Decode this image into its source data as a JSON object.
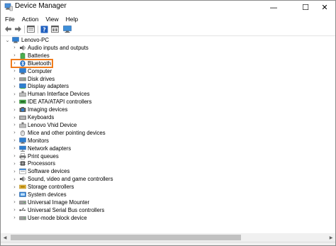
{
  "window": {
    "title": "Device Manager",
    "minimize_glyph": "—",
    "maximize_glyph": "☐",
    "close_glyph": "✕"
  },
  "menu": [
    "File",
    "Action",
    "View",
    "Help"
  ],
  "toolbar": {
    "buttons": [
      "back-arrow-icon",
      "forward-arrow-icon",
      "properties-icon",
      "help-icon",
      "show-hidden-icon",
      "monitor-icon"
    ]
  },
  "tree": {
    "root": "Lenovo-PC",
    "items": [
      {
        "label": "Audio inputs and outputs",
        "icon": "speaker-icon"
      },
      {
        "label": "Batteries",
        "icon": "battery-icon"
      },
      {
        "label": "Bluetooth",
        "icon": "bluetooth-icon"
      },
      {
        "label": "Computer",
        "icon": "computer-icon"
      },
      {
        "label": "Disk drives",
        "icon": "disk-drive-icon"
      },
      {
        "label": "Display adapters",
        "icon": "display-adapter-icon"
      },
      {
        "label": "Human Interface Devices",
        "icon": "hid-icon"
      },
      {
        "label": "IDE ATA/ATAPI controllers",
        "icon": "ide-controller-icon"
      },
      {
        "label": "Imaging devices",
        "icon": "camera-icon"
      },
      {
        "label": "Keyboards",
        "icon": "keyboard-icon"
      },
      {
        "label": "Lenovo Vhid Device",
        "icon": "hid-icon"
      },
      {
        "label": "Mice and other pointing devices",
        "icon": "mouse-icon"
      },
      {
        "label": "Monitors",
        "icon": "monitor-icon"
      },
      {
        "label": "Network adapters",
        "icon": "network-adapter-icon"
      },
      {
        "label": "Print queues",
        "icon": "printer-icon"
      },
      {
        "label": "Processors",
        "icon": "processor-icon"
      },
      {
        "label": "Software devices",
        "icon": "software-device-icon"
      },
      {
        "label": "Sound, video and game controllers",
        "icon": "speaker-icon"
      },
      {
        "label": "Storage controllers",
        "icon": "storage-controller-icon"
      },
      {
        "label": "System devices",
        "icon": "system-device-icon"
      },
      {
        "label": "Universal Image Mounter",
        "icon": "disk-drive-icon"
      },
      {
        "label": "Universal Serial Bus controllers",
        "icon": "usb-icon"
      },
      {
        "label": "User-mode block device",
        "icon": "disk-drive-icon"
      }
    ],
    "highlighted_item": "Bluetooth"
  },
  "colors": {
    "highlight_border": "#f07c1c",
    "bluetooth_blue": "#1565c0",
    "device_blue": "#2f7fd0",
    "folder_yellow": "#e8b94a"
  }
}
